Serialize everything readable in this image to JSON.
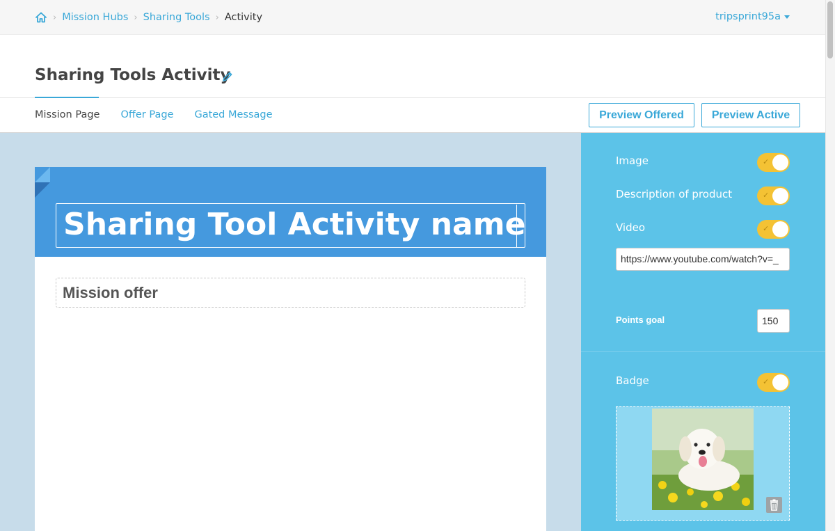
{
  "breadcrumb": {
    "home_icon": "home-icon",
    "items": [
      "Mission Hubs",
      "Sharing Tools"
    ],
    "current": "Activity"
  },
  "user": {
    "name": "tripsprint95a"
  },
  "page": {
    "title": "Sharing Tools Activity",
    "edit_icon": "pencil-icon"
  },
  "tabs": [
    {
      "label": "Mission Page",
      "active": true
    },
    {
      "label": "Offer Page",
      "active": false
    },
    {
      "label": "Gated Message",
      "active": false
    }
  ],
  "actions": {
    "preview_offered": "Preview Offered",
    "preview_active": "Preview Active"
  },
  "content": {
    "headline": "Sharing Tool Activity named",
    "offer": "Mission offer"
  },
  "panel": {
    "image_label": "Image",
    "image_enabled": true,
    "description_label": "Description of product",
    "description_enabled": true,
    "video_label": "Video",
    "video_enabled": true,
    "video_url": "https://www.youtube.com/watch?v=_",
    "points_label": "Points goal",
    "points_value": "150",
    "badge_label": "Badge",
    "badge_enabled": true,
    "badge_image": "dog-in-flowers-photo",
    "trash_icon": "trash-icon"
  },
  "colors": {
    "accent": "#3aa8d8",
    "header_blue": "#4599de",
    "panel_blue": "#5cc3e8",
    "canvas_bg": "#c7dcea",
    "toggle_on": "#f4c234"
  }
}
